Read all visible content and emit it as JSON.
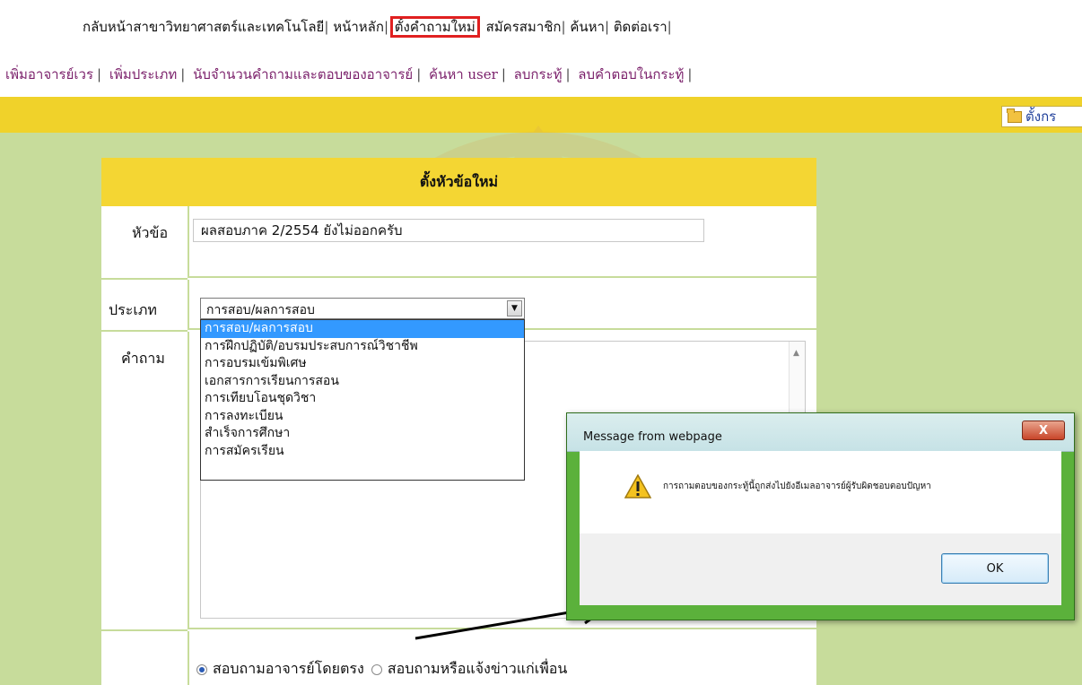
{
  "nav_top": {
    "items": [
      "กลับหน้าสาขาวิทยาศาสตร์และเทคโนโลยี",
      "หน้าหลัก",
      "ตั้งคำถามใหม่",
      "สมัครสมาชิก",
      "ค้นหา",
      "ติดต่อเรา"
    ],
    "separator": "|"
  },
  "nav_admin": {
    "items": [
      "เพิ่มอาจารย์เวร",
      "เพิ่มประเภท",
      "นับจำนวนคำถามและตอบของอาจารย์",
      "ค้นหา user",
      "ลบกระทู้",
      "ลบคำตอบในกระทู้"
    ],
    "separator": "|"
  },
  "bar": {
    "button_label": "ตั้งกร"
  },
  "form": {
    "heading": "ตั้งหัวข้อใหม่",
    "title_label": "หัวข้อ",
    "title_value": "ผลสอบภาค 2/2554 ยังไม่ออกครับ",
    "category_label": "ประเภท",
    "category_selected": "การสอบ/ผลการสอบ",
    "category_options": [
      "การสอบ/ผลการสอบ",
      "การฝึกปฏิบัติ/อบรมประสบการณ์วิชาชีพ",
      "การอบรมเข้มพิเศษ",
      "เอกสารการเรียนการสอน",
      "การเทียบโอนชุดวิชา",
      "การลงทะเบียน",
      "สำเร็จการศึกษา",
      "การสมัครเรียน"
    ],
    "question_label": "คำถาม",
    "radio_1": "สอบถามอาจารย์โดยตรง",
    "radio_2": "สอบถามหรือแจ้งข่าวแก่เพื่อน"
  },
  "dialog": {
    "title": "Message from webpage",
    "close_label": "X",
    "message": "การถามตอบของกระทู้นี้ถูกส่งไปยังอีเมลอาจารย์ผู้รับผิดชอบตอบปัญหา",
    "ok_label": "OK"
  },
  "colors": {
    "accent_yellow": "#f0d22a",
    "page_green": "#c7dc9b",
    "highlight_red": "#e02020",
    "admin_link": "#7a1f6a"
  }
}
